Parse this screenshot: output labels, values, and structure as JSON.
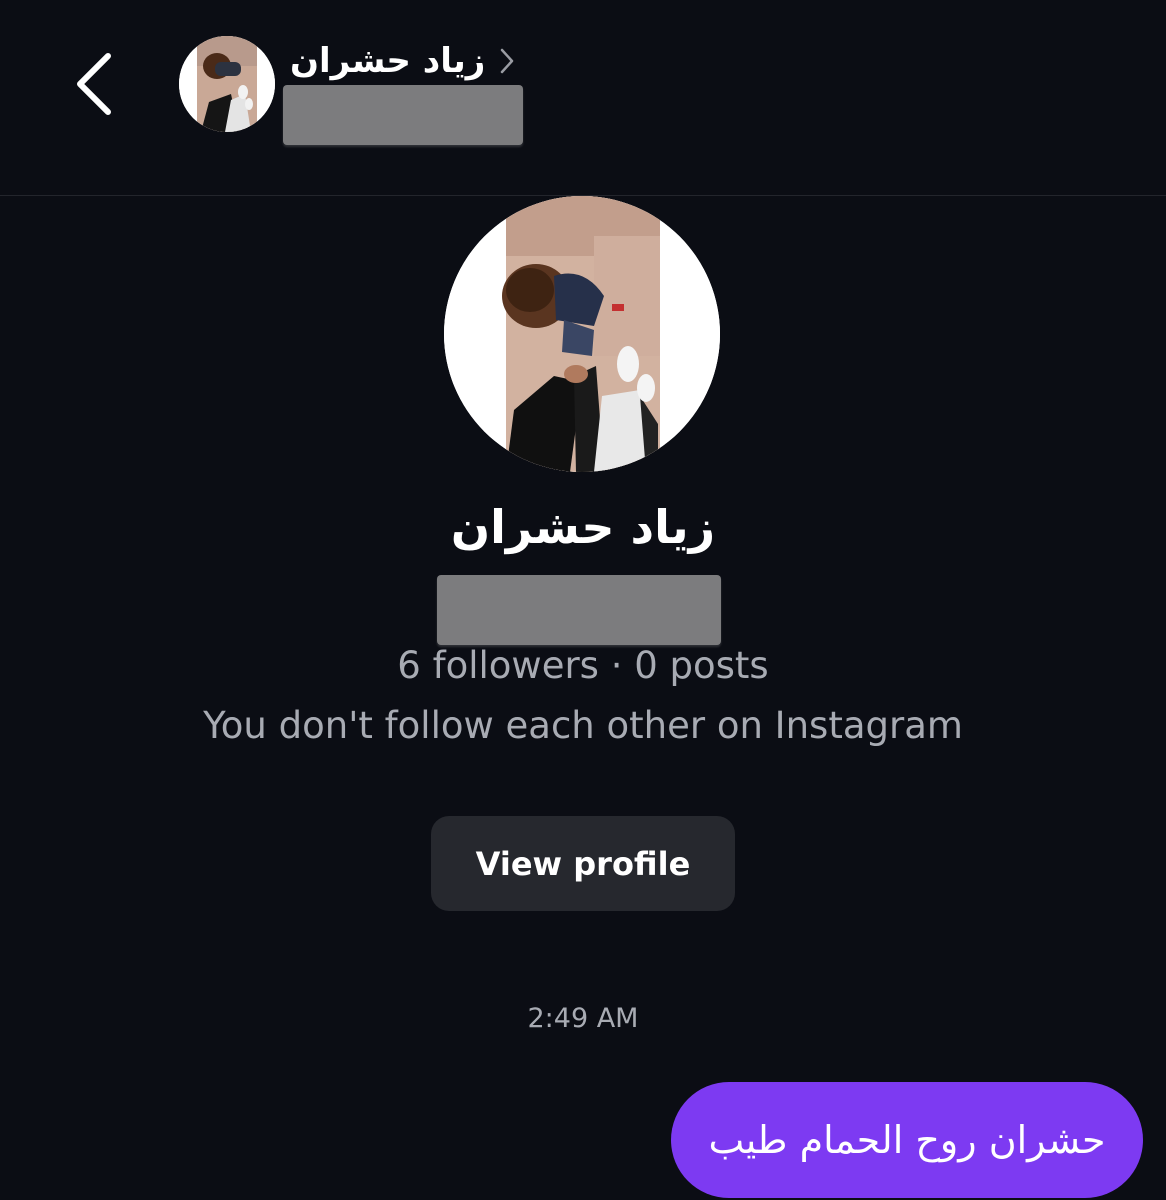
{
  "header": {
    "contact_name": "زياد حشران"
  },
  "profile": {
    "name": "زياد حشران",
    "stats": "6 followers · 0 posts",
    "relation": "You don't follow each other on Instagram",
    "view_profile_label": "View profile"
  },
  "conversation": {
    "timestamp": "2:49 AM",
    "messages": [
      {
        "from": "me",
        "text": "حشران روح الحمام طيب"
      }
    ]
  },
  "colors": {
    "background": "#0b0d14",
    "sent_bubble": "#7d3af2",
    "secondary_text": "#a8abb3",
    "button": "#26282e",
    "redaction": "#7c7c7e"
  },
  "icons": {
    "back": "chevron-left-icon",
    "open_details": "chevron-right-icon"
  }
}
